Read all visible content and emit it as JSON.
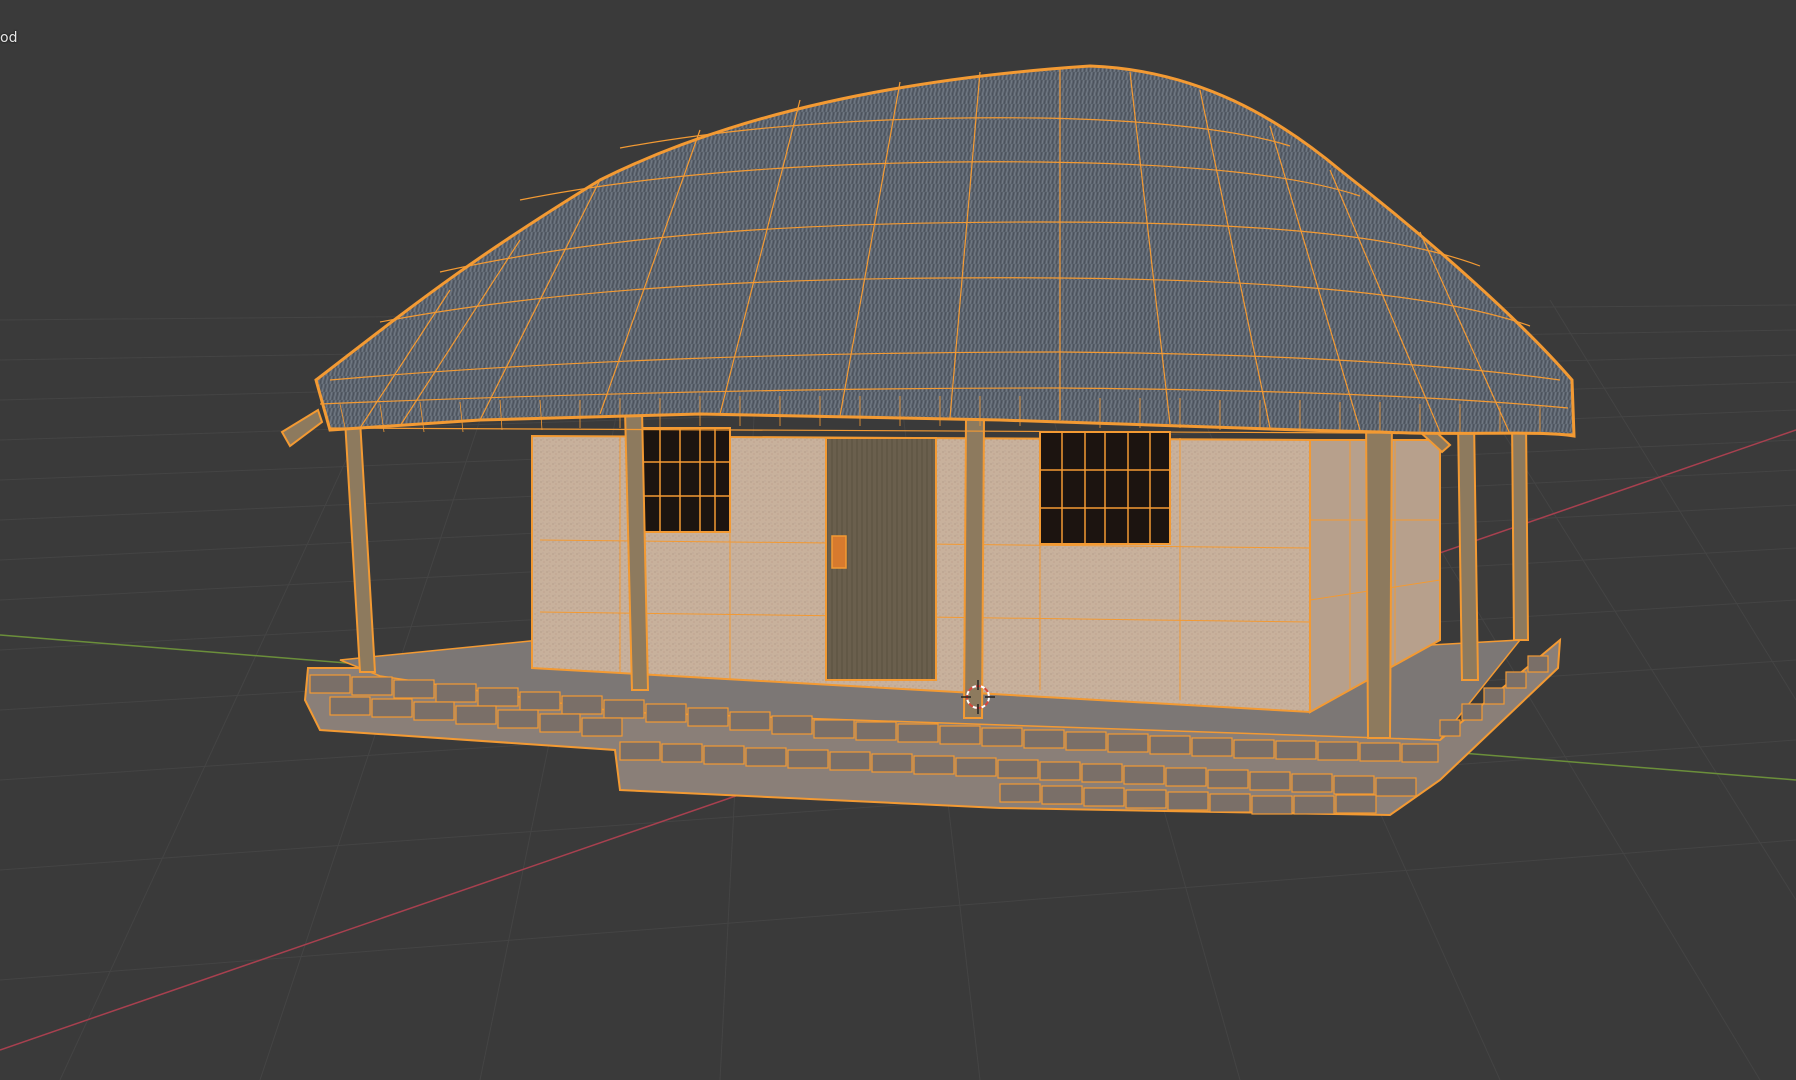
{
  "viewport": {
    "overlay_text": "od"
  },
  "scene": {
    "background_color": "#3a3a3a",
    "grid_color": "#454545",
    "x_axis_color": "#a8404f",
    "y_axis_color": "#6b8f3a",
    "selection_outline_color": "#f39a33",
    "roof_color": "#5e6670",
    "wall_color": "#c9b39e",
    "door_color": "#6a5e4b",
    "stone_color": "#8a7f78",
    "post_color": "#8d7a5e",
    "floor_color": "#7c7775",
    "cursor_icon": "3d-cursor-icon"
  }
}
